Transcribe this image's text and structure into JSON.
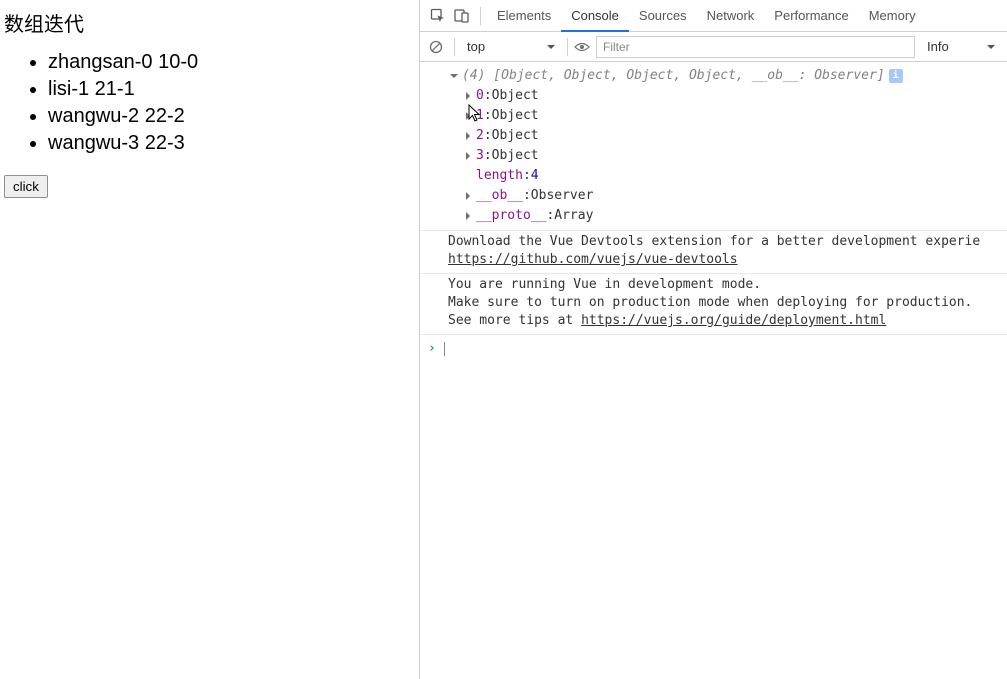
{
  "page": {
    "title": "数组迭代",
    "items": [
      "zhangsan-0 10-0",
      "lisi-1 21-1",
      "wangwu-2 22-2",
      "wangwu-3 22-3"
    ],
    "button_label": "click"
  },
  "devtools": {
    "tabs": [
      "Elements",
      "Console",
      "Sources",
      "Network",
      "Performance",
      "Memory"
    ],
    "active_tab_index": 1,
    "toolbar": {
      "context": "top",
      "filter_placeholder": "Filter",
      "level": "Info"
    },
    "log": {
      "summary": "(4) [Object, Object, Object, Object, __ob__: Observer]",
      "entries": [
        {
          "key": "0",
          "value": "Object",
          "key_purple": true
        },
        {
          "key": "1",
          "value": "Object",
          "key_purple": true
        },
        {
          "key": "2",
          "value": "Object",
          "key_purple": true
        },
        {
          "key": "3",
          "value": "Object",
          "key_purple": true
        }
      ],
      "length_key": "length",
      "length_value": "4",
      "ob_key": "__ob__",
      "ob_value": "Observer",
      "proto_key": "__proto__",
      "proto_value": "Array"
    },
    "messages": [
      {
        "lines": [
          "Download the Vue Devtools extension for a better development experie"
        ],
        "link": "https://github.com/vuejs/vue-devtools"
      },
      {
        "lines": [
          "You are running Vue in development mode.",
          "Make sure to turn on production mode when deploying for production.",
          "See more tips at "
        ],
        "link": "https://vuejs.org/guide/deployment.html"
      }
    ],
    "info_badge": "i"
  }
}
